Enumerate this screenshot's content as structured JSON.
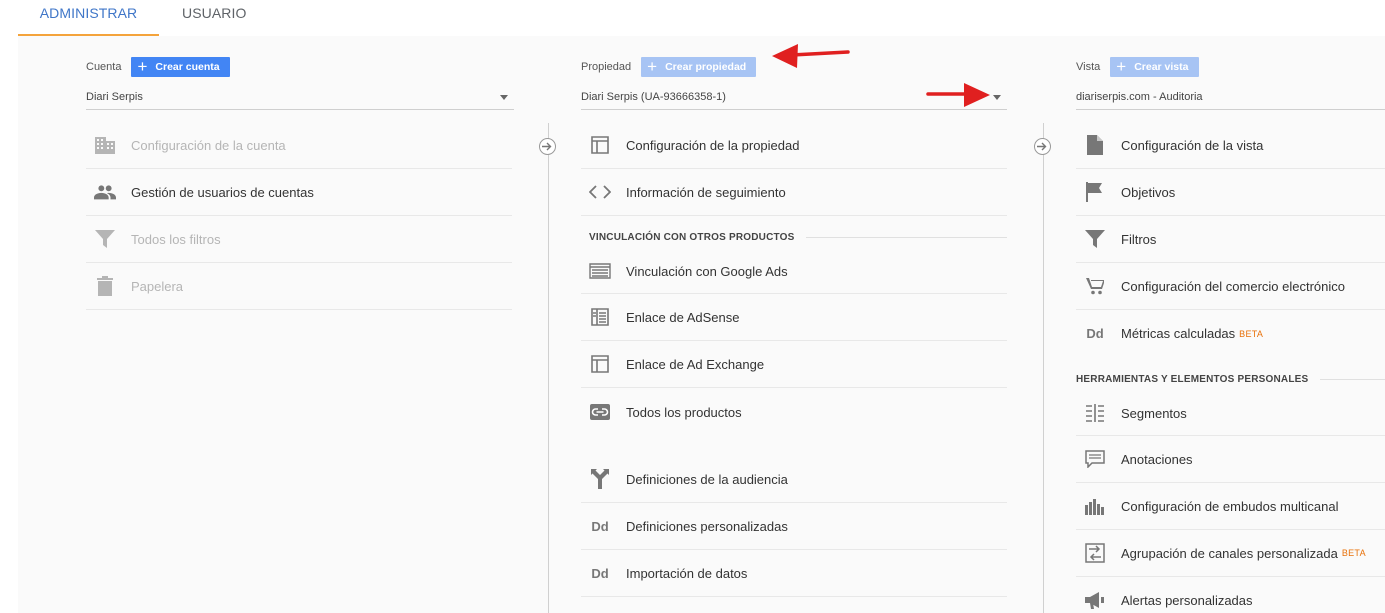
{
  "tabs": {
    "admin": "ADMINISTRAR",
    "user": "USUARIO"
  },
  "account": {
    "label": "Cuenta",
    "create_button": "Crear cuenta",
    "selected": "Diari Serpis",
    "items": [
      {
        "label": "Configuración de la cuenta",
        "icon": "building-icon",
        "disabled": true
      },
      {
        "label": "Gestión de usuarios de cuentas",
        "icon": "people-icon",
        "disabled": false
      },
      {
        "label": "Todos los filtros",
        "icon": "filter-icon",
        "disabled": true
      },
      {
        "label": "Papelera",
        "icon": "trash-icon",
        "disabled": true
      }
    ]
  },
  "property": {
    "label": "Propiedad",
    "create_button": "Crear propiedad",
    "selected": "Diari Serpis (UA-93666358-1)",
    "items": [
      {
        "label": "Configuración de la propiedad",
        "icon": "window-icon"
      },
      {
        "label": "Información de seguimiento",
        "icon": "code-icon"
      }
    ],
    "section_title": "VINCULACIÓN CON OTROS PRODUCTOS",
    "linked_items": [
      {
        "label": "Vinculación con Google Ads",
        "icon": "ads-icon"
      },
      {
        "label": "Enlace de AdSense",
        "icon": "adsense-icon"
      },
      {
        "label": "Enlace de Ad Exchange",
        "icon": "adexchange-icon"
      },
      {
        "label": "Todos los productos",
        "icon": "link-icon"
      }
    ],
    "more_items": [
      {
        "label": "Definiciones de la audiencia",
        "icon": "audience-icon"
      },
      {
        "label": "Definiciones personalizadas",
        "icon": "dd-icon"
      },
      {
        "label": "Importación de datos",
        "icon": "dd-icon"
      }
    ]
  },
  "view": {
    "label": "Vista",
    "create_button": "Crear vista",
    "selected": "diariserpis.com - Auditoria",
    "items": [
      {
        "label": "Configuración de la vista",
        "icon": "document-icon"
      },
      {
        "label": "Objetivos",
        "icon": "flag-icon"
      },
      {
        "label": "Filtros",
        "icon": "filter-icon"
      },
      {
        "label": "Configuración del comercio electrónico",
        "icon": "cart-icon"
      },
      {
        "label": "Métricas calculadas",
        "icon": "dd-icon",
        "badge": "BETA"
      }
    ],
    "section_title": "HERRAMIENTAS Y ELEMENTOS PERSONALES",
    "tool_items": [
      {
        "label": "Segmentos",
        "icon": "segments-icon"
      },
      {
        "label": "Anotaciones",
        "icon": "annotation-icon"
      },
      {
        "label": "Configuración de embudos multicanal",
        "icon": "bar-chart-icon"
      },
      {
        "label": "Agrupación de canales personalizada",
        "icon": "channel-group-icon",
        "badge": "BETA"
      },
      {
        "label": "Alertas personalizadas",
        "icon": "megaphone-icon"
      }
    ]
  },
  "colors": {
    "accent": "#4285f4",
    "tab_active": "#3f76c8",
    "tab_underline": "#f4a33b",
    "annotation_arrow": "#e02020",
    "beta": "#e8710a"
  }
}
